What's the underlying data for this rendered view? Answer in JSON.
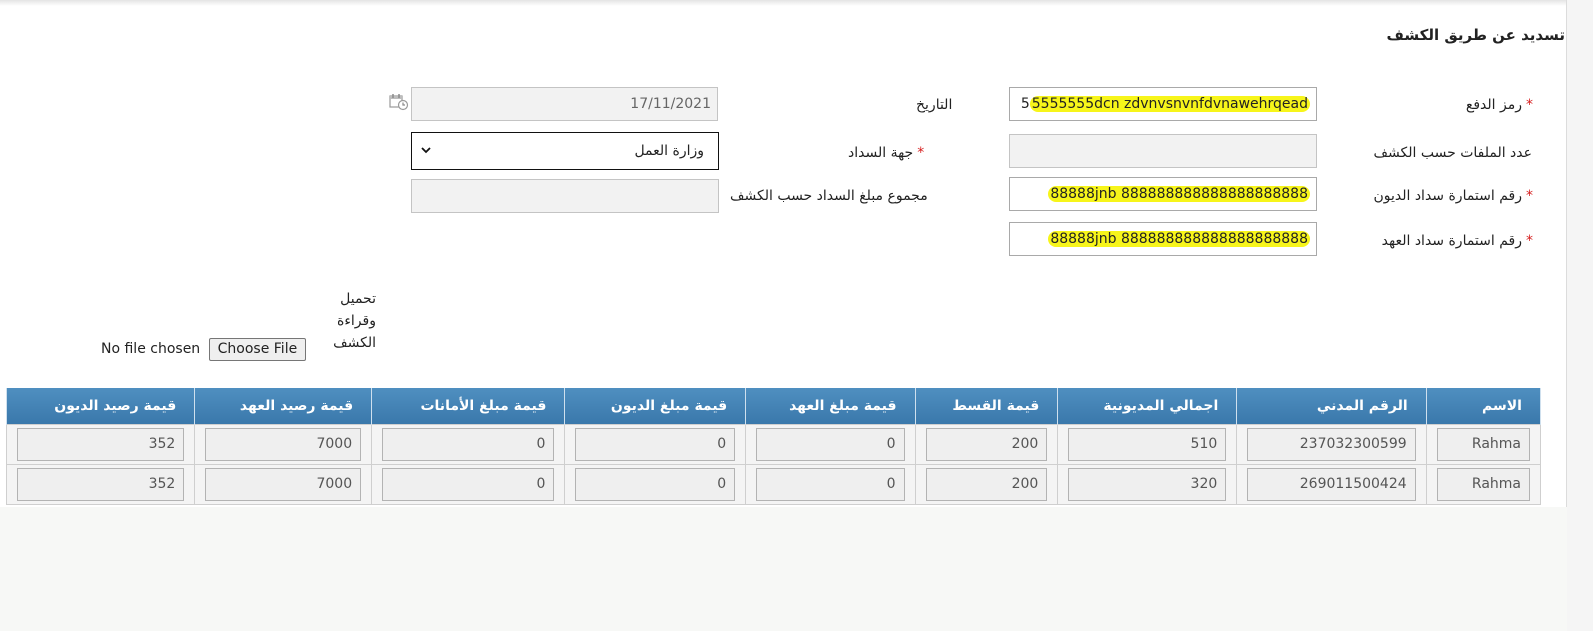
{
  "page_title": "تسديد عن طريق الكشف",
  "form": {
    "payment_code": {
      "label": "رمز الدفع",
      "value_prefix": "5",
      "value_highlight": "5555555dcn zdvnvsnvnfdvnawehrqead"
    },
    "date": {
      "label": "التاريخ",
      "value": "17/11/2021"
    },
    "files_count": {
      "label": "عدد الملفات حسب الكشف",
      "value": ""
    },
    "payer_entity": {
      "label": "جهة السداد",
      "value": "وزارة العمل"
    },
    "debts_form_number": {
      "label": "رقم استمارة سداد الديون",
      "value": "88888jnb 888888888888888888888"
    },
    "total_amount": {
      "label": "مجموع مبلغ السداد حسب الكشف",
      "value": ""
    },
    "custody_form_number": {
      "label": "رقم استمارة سداد العهد",
      "value": "88888jnb 888888888888888888888"
    },
    "required_mark": "*"
  },
  "upload": {
    "label_line1": "تحميل",
    "label_line2": "وقراءة",
    "label_line3": "الكشف",
    "button_label": "Choose File",
    "status": "No file chosen"
  },
  "table": {
    "headers": [
      "الاسم",
      "الرقم المدني",
      "اجمالي المديونية",
      "قيمة القسط",
      "قيمة مبلغ العهد",
      "قيمة مبلغ الديون",
      "قيمة مبلغ الأمانات",
      "قيمة رصيد العهد",
      "قيمة رصيد الديون"
    ],
    "rows": [
      [
        "Rahma",
        "237032300599",
        "510",
        "200",
        "0",
        "0",
        "0",
        "7000",
        "352"
      ],
      [
        "Rahma",
        "269011500424",
        "320",
        "200",
        "0",
        "0",
        "0",
        "7000",
        "352"
      ]
    ]
  }
}
